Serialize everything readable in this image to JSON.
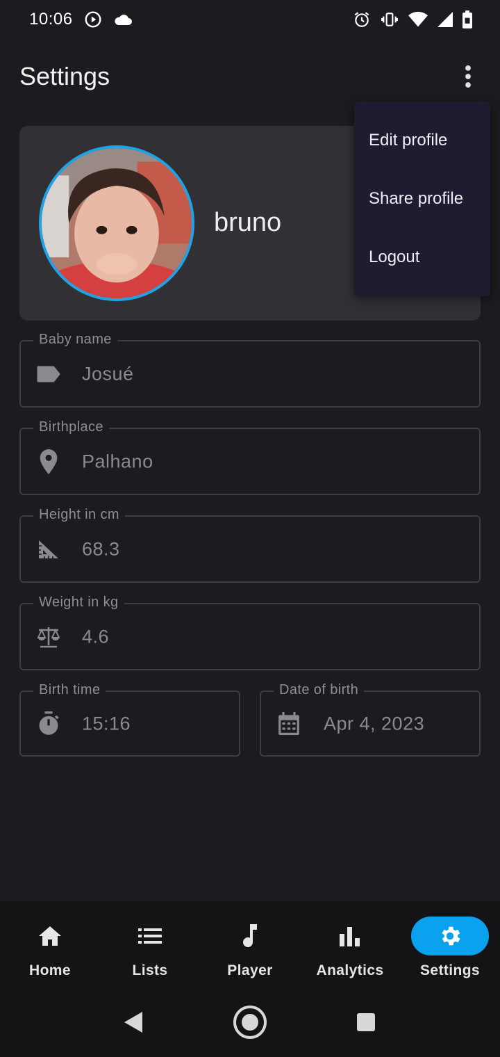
{
  "status_bar": {
    "time": "10:06",
    "icons": [
      "play-circle-icon",
      "cloud-icon",
      "alarm-icon",
      "vibrate-icon",
      "wifi-icon",
      "signal-icon",
      "battery-icon"
    ]
  },
  "app_bar": {
    "title": "Settings",
    "more_icon": "more-vert-icon"
  },
  "profile": {
    "name": "bruno",
    "avatar_border_color": "#1fa3e6"
  },
  "menu": {
    "items": [
      {
        "label": "Edit profile"
      },
      {
        "label": "Share profile"
      },
      {
        "label": "Logout"
      }
    ]
  },
  "fields": {
    "baby_name": {
      "label": "Baby name",
      "value": "Josué",
      "icon": "label-tag-icon"
    },
    "birthplace": {
      "label": "Birthplace",
      "value": "Palhano",
      "icon": "location-pin-icon"
    },
    "height": {
      "label": "Height in cm",
      "value": "68.3",
      "icon": "ruler-triangle-icon"
    },
    "weight": {
      "label": "Weight in kg",
      "value": "4.6",
      "icon": "scale-icon"
    },
    "birth_time": {
      "label": "Birth time",
      "value": "15:16",
      "icon": "stopwatch-icon"
    },
    "date_of_birth": {
      "label": "Date of birth",
      "value": "Apr 4, 2023",
      "icon": "calendar-icon"
    }
  },
  "bottom_nav": {
    "active_color": "#0aa2ee",
    "items": [
      {
        "label": "Home",
        "icon": "home-icon"
      },
      {
        "label": "Lists",
        "icon": "list-icon"
      },
      {
        "label": "Player",
        "icon": "music-note-icon"
      },
      {
        "label": "Analytics",
        "icon": "bar-chart-icon"
      },
      {
        "label": "Settings",
        "icon": "gear-icon",
        "active": true
      }
    ]
  },
  "system_nav": {
    "icons": [
      "back-icon",
      "home-circle-icon",
      "recents-icon"
    ]
  }
}
